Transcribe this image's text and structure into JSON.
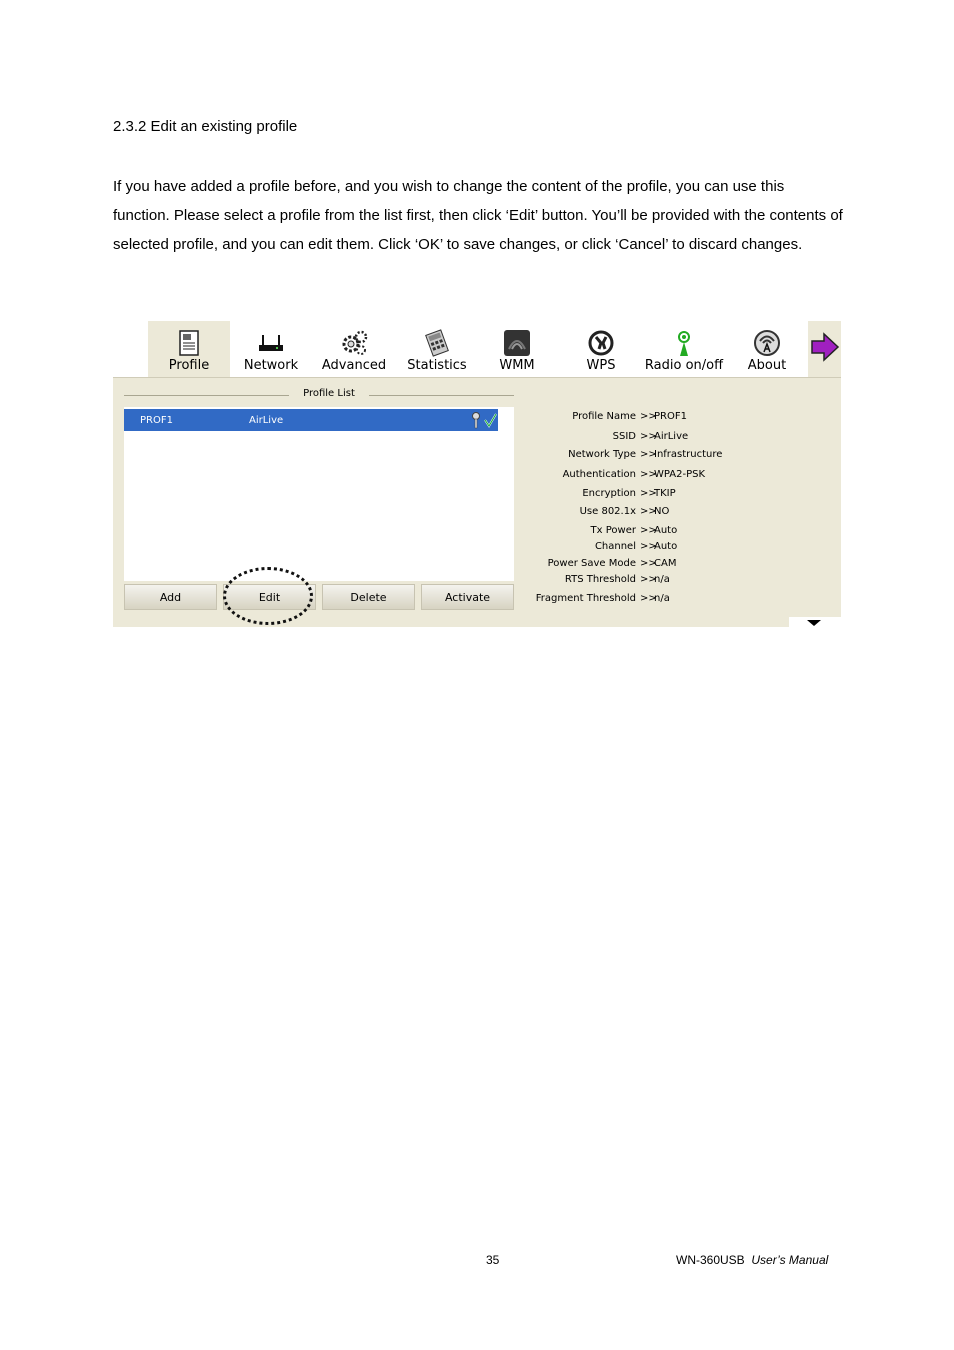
{
  "heading": "2.3.2 Edit an existing profile",
  "paragraph": "If you have added a profile before, and you wish to change the content of the profile, you can use this function. Please select a profile from the list first, then click ‘Edit’ button. You’ll be provided with the contents of selected profile, and you can edit them. Click ‘OK’ to save changes, or click ‘Cancel’ to discard changes.",
  "toolbar": {
    "items": [
      {
        "label": "Profile",
        "icon": "profile-icon"
      },
      {
        "label": "Network",
        "icon": "network-router-icon"
      },
      {
        "label": "Advanced",
        "icon": "gears-icon"
      },
      {
        "label": "Statistics",
        "icon": "calculator-icon"
      },
      {
        "label": "WMM",
        "icon": "qos-icon"
      },
      {
        "label": "WPS",
        "icon": "wps-icon"
      },
      {
        "label": "Radio on/off",
        "icon": "radio-icon"
      },
      {
        "label": "About",
        "icon": "about-icon"
      }
    ],
    "active": "Profile"
  },
  "profile_list": {
    "title": "Profile List",
    "rows": [
      {
        "name": "PROF1",
        "ssid": "AirLive"
      }
    ]
  },
  "buttons": {
    "add": "Add",
    "edit": "Edit",
    "delete": "Delete",
    "activate": "Activate"
  },
  "details": [
    {
      "key": "Profile Name",
      "value": "PROF1"
    },
    {
      "key": "SSID",
      "value": "AirLive"
    },
    {
      "key": "Network Type",
      "value": "Infrastructure"
    },
    {
      "key": "Authentication",
      "value": "WPA2-PSK"
    },
    {
      "key": "Encryption",
      "value": "TKIP"
    },
    {
      "key": "Use 802.1x",
      "value": "NO"
    },
    {
      "key": "Tx Power",
      "value": "Auto"
    },
    {
      "key": "Channel",
      "value": "Auto"
    },
    {
      "key": "Power Save Mode",
      "value": "CAM"
    },
    {
      "key": "RTS Threshold",
      "value": "n/a"
    },
    {
      "key": "Fragment Threshold",
      "value": "n/a"
    }
  ],
  "details_separator": ">>",
  "colors": {
    "selection": "#316ac5",
    "panel": "#ece9d8"
  },
  "footer": {
    "page_number": "35",
    "product": "WN-360USB",
    "manual": "User’s Manual"
  }
}
